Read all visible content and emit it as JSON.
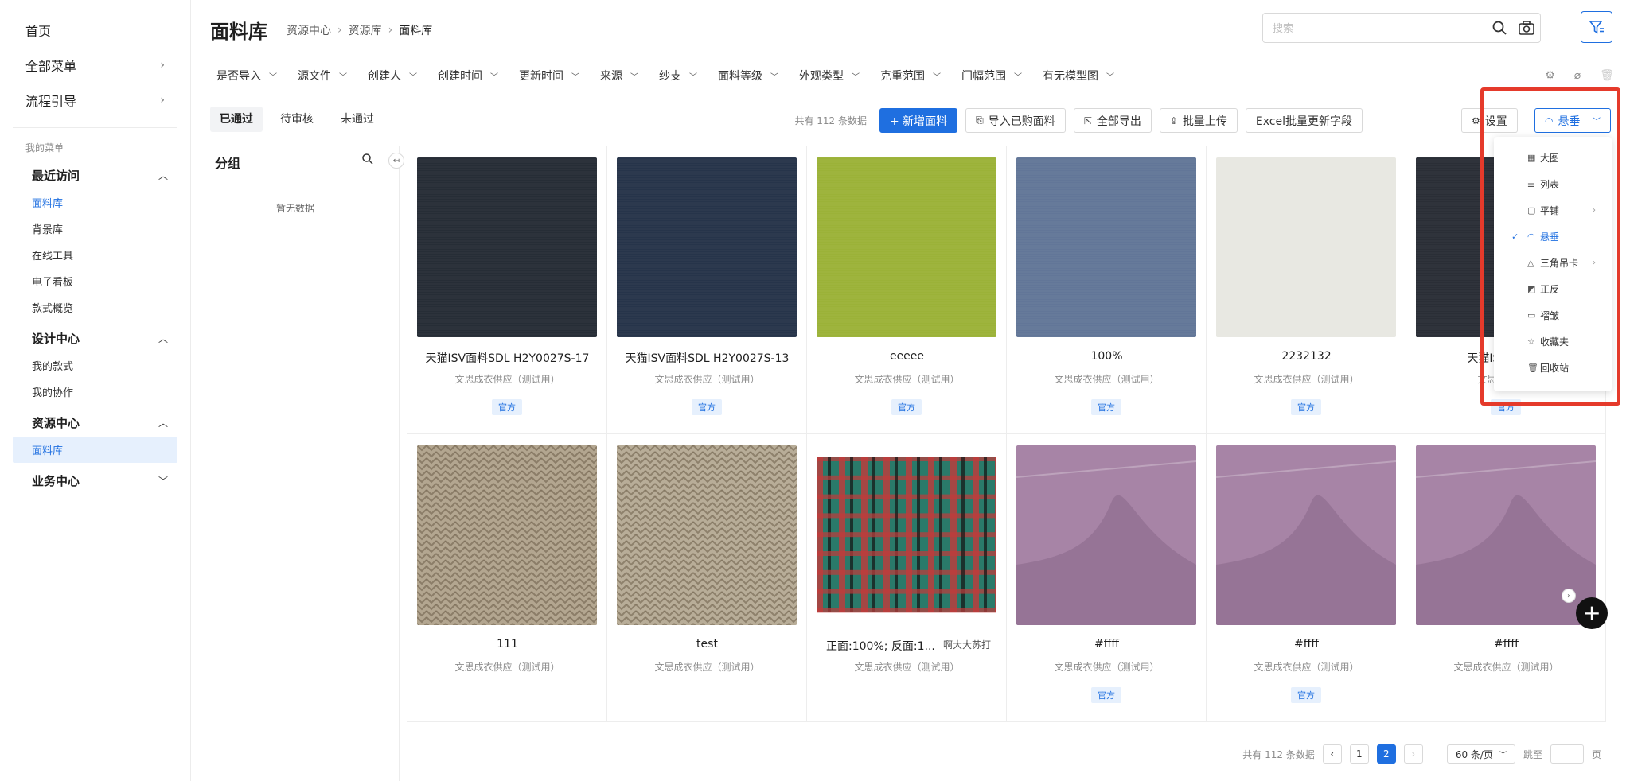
{
  "sidebar": {
    "top_items": [
      {
        "label": "首页",
        "has_arrow": false
      },
      {
        "label": "全部菜单",
        "has_arrow": true
      },
      {
        "label": "流程引导",
        "has_arrow": true
      }
    ],
    "section_label": "我的菜单",
    "groups": [
      {
        "label": "最近访问",
        "items": [
          "面料库",
          "背景库",
          "在线工具",
          "电子看板",
          "款式概览"
        ]
      },
      {
        "label": "设计中心",
        "items": [
          "我的款式",
          "我的协作"
        ]
      },
      {
        "label": "资源中心",
        "items": [
          "面料库"
        ]
      },
      {
        "label": "业务中心",
        "items": []
      }
    ]
  },
  "header": {
    "title": "面料库",
    "breadcrumb": [
      "资源中心",
      "资源库",
      "面料库"
    ],
    "search_placeholder": "搜索"
  },
  "filters": [
    "是否导入",
    "源文件",
    "创建人",
    "创建时间",
    "更新时间",
    "来源",
    "纱支",
    "面料等级",
    "外观类型",
    "克重范围",
    "门幅范围",
    "有无模型图"
  ],
  "toolbar": {
    "status_tabs": [
      "已通过",
      "待审核",
      "未通过"
    ],
    "count_text": "共有 112 条数据",
    "buttons": {
      "new": "+ 新增面料",
      "import": "导入已购面料",
      "export": "全部导出",
      "upload": "批量上传",
      "excel": "Excel批量更新字段",
      "settings": "设置",
      "view": "悬垂"
    }
  },
  "group_panel": {
    "title": "分组",
    "empty_text": "暂无数据"
  },
  "cards": [
    {
      "name": "天猫ISV面料SDL H2Y0027S-17",
      "supplier": "文思成衣供应（测试用）",
      "tag": "官方",
      "color": "#262d36"
    },
    {
      "name": "天猫ISV面料SDL H2Y0027S-13",
      "supplier": "文思成衣供应（测试用）",
      "tag": "官方",
      "color": "#26344a"
    },
    {
      "name": "eeeee",
      "supplier": "文思成衣供应（测试用）",
      "tag": "官方",
      "color": "#9bb238"
    },
    {
      "name": "100%",
      "supplier": "文思成衣供应（测试用）",
      "tag": "官方",
      "color": "#627698"
    },
    {
      "name": "2232132",
      "supplier": "文思成衣供应（测试用）",
      "tag": "官方",
      "color": "#e8e8e2"
    },
    {
      "name": "天猫ISV面料SD",
      "supplier": "文思成衣供应",
      "tag": "官方",
      "color": "#2a2e36"
    },
    {
      "name": "111",
      "supplier": "文思成衣供应（测试用）",
      "tag": "",
      "color": "#b3a690"
    },
    {
      "name": "test",
      "supplier": "文思成衣供应（测试用）",
      "tag": "",
      "color": "#b8ad98"
    },
    {
      "name": "正面:100%; 反面:1...",
      "extra": "啊大大苏打",
      "supplier": "文思成衣供应（测试用）",
      "tag": "",
      "color": "#2a7a6a"
    },
    {
      "name": "#ffff",
      "supplier": "文思成衣供应（测试用）",
      "tag": "官方",
      "color": "#a784a6"
    },
    {
      "name": "#ffff",
      "supplier": "文思成衣供应（测试用）",
      "tag": "官方",
      "color": "#a784a6"
    },
    {
      "name": "#ffff",
      "supplier": "文思成衣供应（测试用）",
      "tag": "",
      "color": "#a784a6"
    }
  ],
  "pagination": {
    "total_text": "共有 112 条数据",
    "pages": [
      "1",
      "2"
    ],
    "current": "2",
    "page_size": "60 条/页",
    "jump_label": "跳至",
    "page_unit": "页"
  },
  "view_menu": {
    "items": [
      {
        "label": "大图",
        "icon": "grid-icon",
        "glyph": "▦",
        "selected": false,
        "submenu": false
      },
      {
        "label": "列表",
        "icon": "list-icon",
        "glyph": "☰",
        "selected": false,
        "submenu": false
      },
      {
        "label": "平铺",
        "icon": "tile-icon",
        "glyph": "▢",
        "selected": false,
        "submenu": true
      },
      {
        "label": "悬垂",
        "icon": "drape-icon",
        "glyph": "◠",
        "selected": true,
        "submenu": false
      },
      {
        "label": "三角吊卡",
        "icon": "hanger-icon",
        "glyph": "△",
        "selected": false,
        "submenu": true
      },
      {
        "label": "正反",
        "icon": "flip-icon",
        "glyph": "◩",
        "selected": false,
        "submenu": false
      },
      {
        "label": "褶皱",
        "icon": "fold-icon",
        "glyph": "▭",
        "selected": false,
        "submenu": false
      },
      {
        "label": "收藏夹",
        "icon": "star-icon",
        "glyph": "☆",
        "selected": false,
        "submenu": false
      },
      {
        "label": "回收站",
        "icon": "trash-icon",
        "glyph": "🗑",
        "selected": false,
        "submenu": false
      }
    ]
  },
  "colors": {
    "accent": "#1f6fe0",
    "highlight": "#e53a2b"
  }
}
